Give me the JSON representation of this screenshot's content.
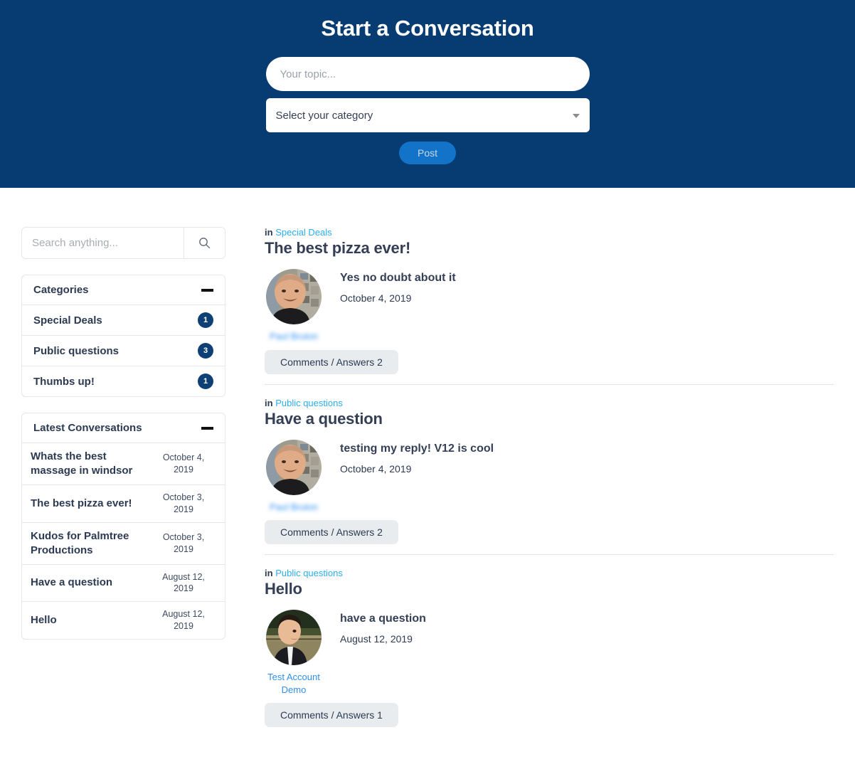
{
  "hero": {
    "title": "Start a Conversation",
    "topic_placeholder": "Your topic...",
    "topic_value": "",
    "category_selected": "Select your category",
    "category_options": [
      "Select your category",
      "Special Deals",
      "Public questions",
      "Thumbs up!"
    ],
    "post_label": "Post",
    "bg_color": "#073c72",
    "post_button_color": "#1273c9"
  },
  "sidebar": {
    "search": {
      "placeholder": "Search anything...",
      "value": "",
      "icon": "search-icon"
    },
    "categories_panel": {
      "title": "Categories",
      "collapse_icon": "minus-icon",
      "items": [
        {
          "label": "Special Deals",
          "count": "1"
        },
        {
          "label": "Public questions",
          "count": "3"
        },
        {
          "label": "Thumbs up!",
          "count": "1"
        }
      ]
    },
    "latest_panel": {
      "title": "Latest Conversations",
      "collapse_icon": "minus-icon",
      "items": [
        {
          "title": "Whats the best massage in windsor",
          "date": "October 4, 2019"
        },
        {
          "title": "The best pizza ever!",
          "date": "October 3, 2019"
        },
        {
          "title": "Kudos for Palmtree Productions",
          "date": "October 3, 2019"
        },
        {
          "title": "Have a question",
          "date": "August 12, 2019"
        },
        {
          "title": "Hello",
          "date": "August 12, 2019"
        }
      ]
    },
    "badge_color": "#0e4076"
  },
  "main": {
    "in_label": "in",
    "posts": [
      {
        "category": "Special Deals",
        "title": "The best pizza ever!",
        "reply_text": "Yes no doubt about it",
        "reply_date": "October 4, 2019",
        "author": "Paul Bruton",
        "author_blurred": true,
        "comments_label": "Comments / Answers 2"
      },
      {
        "category": "Public questions",
        "title": "Have a question",
        "reply_text": "testing my reply! V12 is cool",
        "reply_date": "October 4, 2019",
        "author": "Paul Bruton",
        "author_blurred": true,
        "comments_label": "Comments / Answers 2"
      },
      {
        "category": "Public questions",
        "title": "Hello",
        "reply_text": "have a question",
        "reply_date": "August 12, 2019",
        "author": "Test Account Demo",
        "author_blurred": false,
        "comments_label": "Comments / Answers 1"
      }
    ],
    "link_color": "#2badee"
  }
}
